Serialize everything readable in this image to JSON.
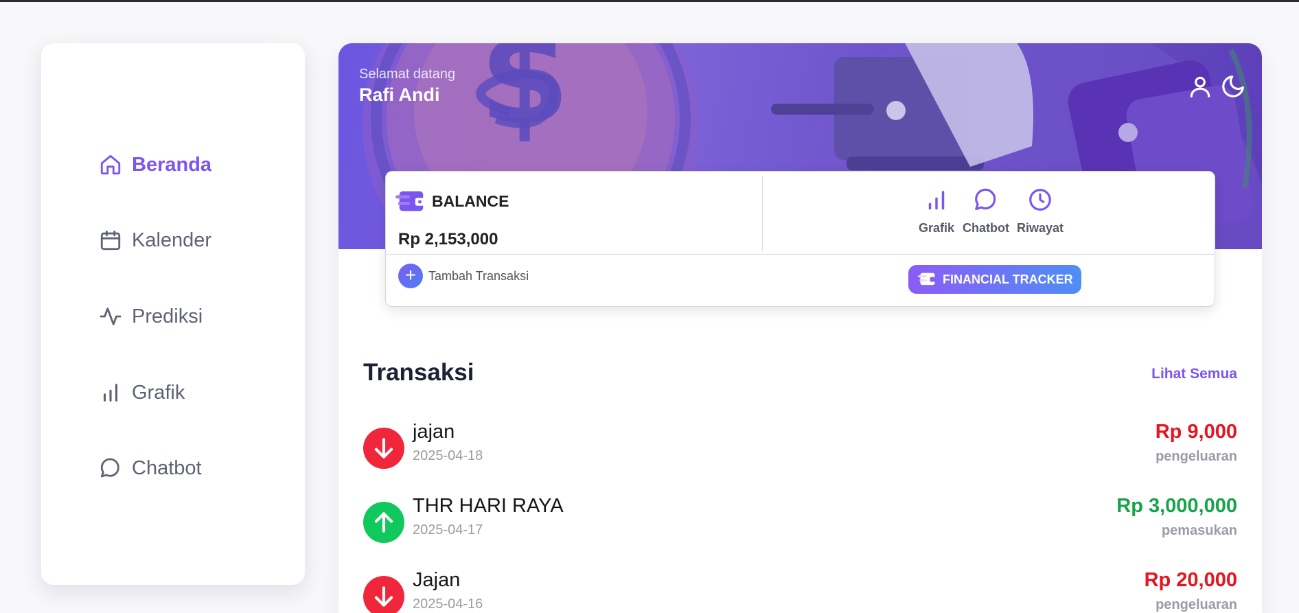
{
  "sidebar": {
    "items": [
      {
        "label": "Beranda",
        "icon": "home-icon"
      },
      {
        "label": "Kalender",
        "icon": "calendar-icon"
      },
      {
        "label": "Prediksi",
        "icon": "activity-icon"
      },
      {
        "label": "Grafik",
        "icon": "bar-chart-icon"
      },
      {
        "label": "Chatbot",
        "icon": "chat-icon"
      }
    ],
    "active_index": 0
  },
  "header": {
    "greeting": "Selamat datang",
    "user_name": "Rafi Andi",
    "icons": [
      "user-icon",
      "moon-icon"
    ]
  },
  "balance": {
    "label": "BALANCE",
    "amount": "Rp 2,153,000",
    "quick_actions": [
      {
        "label": "Grafik",
        "icon": "bar-chart-icon"
      },
      {
        "label": "Chatbot",
        "icon": "chat-icon"
      },
      {
        "label": "Riwayat",
        "icon": "clock-icon"
      }
    ],
    "add_transaction_label": "Tambah Transaksi",
    "badge_label": "FINANCIAL TRACKER"
  },
  "transactions": {
    "title": "Transaksi",
    "see_all": "Lihat Semua",
    "items": [
      {
        "name": "jajan",
        "date": "2025-04-18",
        "amount": "Rp 9,000",
        "type": "pengeluaran",
        "direction": "down"
      },
      {
        "name": "THR HARI RAYA",
        "date": "2025-04-17",
        "amount": "Rp 3,000,000",
        "type": "pemasukan",
        "direction": "up"
      },
      {
        "name": "Jajan",
        "date": "2025-04-16",
        "amount": "Rp 20,000",
        "type": "pengeluaran",
        "direction": "down"
      }
    ]
  },
  "colors": {
    "accent": "#7b55f0",
    "expense": "#f0273a",
    "income": "#11c85c",
    "expense_text": "#e5141f",
    "income_text": "#16a34a"
  }
}
